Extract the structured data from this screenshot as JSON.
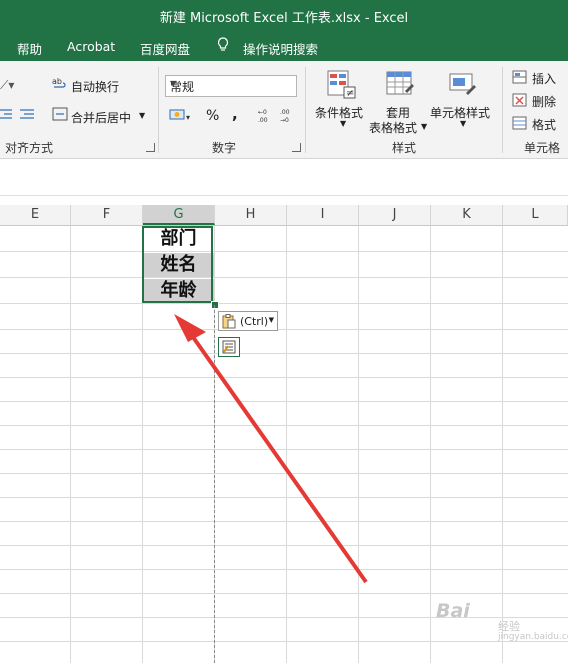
{
  "window": {
    "title": "新建 Microsoft Excel 工作表.xlsx  -  Excel",
    "accent": "#217346"
  },
  "tabs": [
    "帮助",
    "Acrobat",
    "百度网盘",
    "操作说明搜索"
  ],
  "ribbon": {
    "alignment": {
      "wrap_text": "自动换行",
      "merge_center": "合并后居中",
      "group_label": "对齐方式"
    },
    "number": {
      "format": "常规",
      "percent": "%",
      "comma": ",",
      "group_label": "数字"
    },
    "styles": {
      "conditional": "条件格式",
      "table_line1": "套用",
      "table_line2": "表格格式",
      "cell_styles": "单元格样式",
      "group_label": "样式"
    },
    "cells": {
      "insert": "插入",
      "delete": "删除",
      "format": "格式",
      "group_label": "单元格"
    }
  },
  "columns": [
    "E",
    "F",
    "G",
    "H",
    "I",
    "J",
    "K",
    "L"
  ],
  "selected_column": "G",
  "cells": [
    "部门",
    "姓名",
    "年龄"
  ],
  "paste_options": {
    "label": "(Ctrl)"
  },
  "annotation": {
    "arrow_color": "#e53935"
  },
  "watermark": {
    "brand": "Bai",
    "text": "经验",
    "url": "jingyan.baidu.com"
  }
}
